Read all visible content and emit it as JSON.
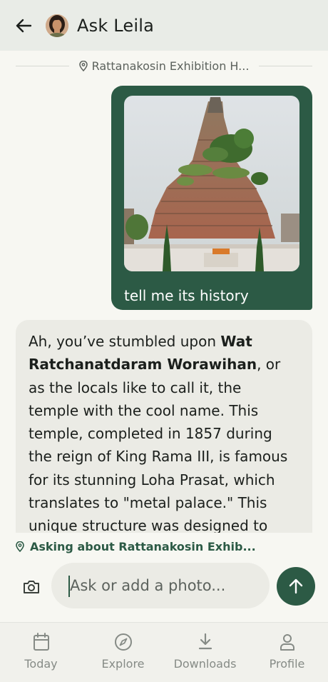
{
  "header": {
    "title": "Ask Leila",
    "back_icon": "arrow-left-icon",
    "avatar_icon": "avatar"
  },
  "location_divider": {
    "text": "Rattanakosin Exhibition H...",
    "icon": "location-pin-icon"
  },
  "chat": {
    "user_message": {
      "text": "tell me its history",
      "photo": "photo of Loha Prasat brick stupa with plants on top"
    },
    "assistant_message": {
      "intro": "Ah, you’ve stumbled upon ",
      "highlight": "Wat Ratchanatdaram Worawihan",
      "body": ", or as the locals like to call it, the temple with the cool name. This temple, completed in 1857 during the reign of King Rama III, is famous for its stunning Loha Prasat, which translates to \"metal palace.\" This unique structure was designed to"
    }
  },
  "context": {
    "text": "Asking about Rattanakosin Exhib...",
    "icon": "location-pin-icon"
  },
  "composer": {
    "placeholder": "Ask or add a photo...",
    "camera_icon": "camera-icon",
    "send_icon": "arrow-up-icon"
  },
  "bottom_nav": {
    "items": [
      {
        "label": "Today",
        "icon": "calendar-icon"
      },
      {
        "label": "Explore",
        "icon": "compass-icon"
      },
      {
        "label": "Downloads",
        "icon": "download-icon"
      },
      {
        "label": "Profile",
        "icon": "person-icon"
      }
    ]
  },
  "colors": {
    "accent": "#2c5a45",
    "background": "#f7f7f2",
    "header_bg": "#e9ece7",
    "bubble_bg": "#ebebe5",
    "muted_text": "#868b86"
  }
}
